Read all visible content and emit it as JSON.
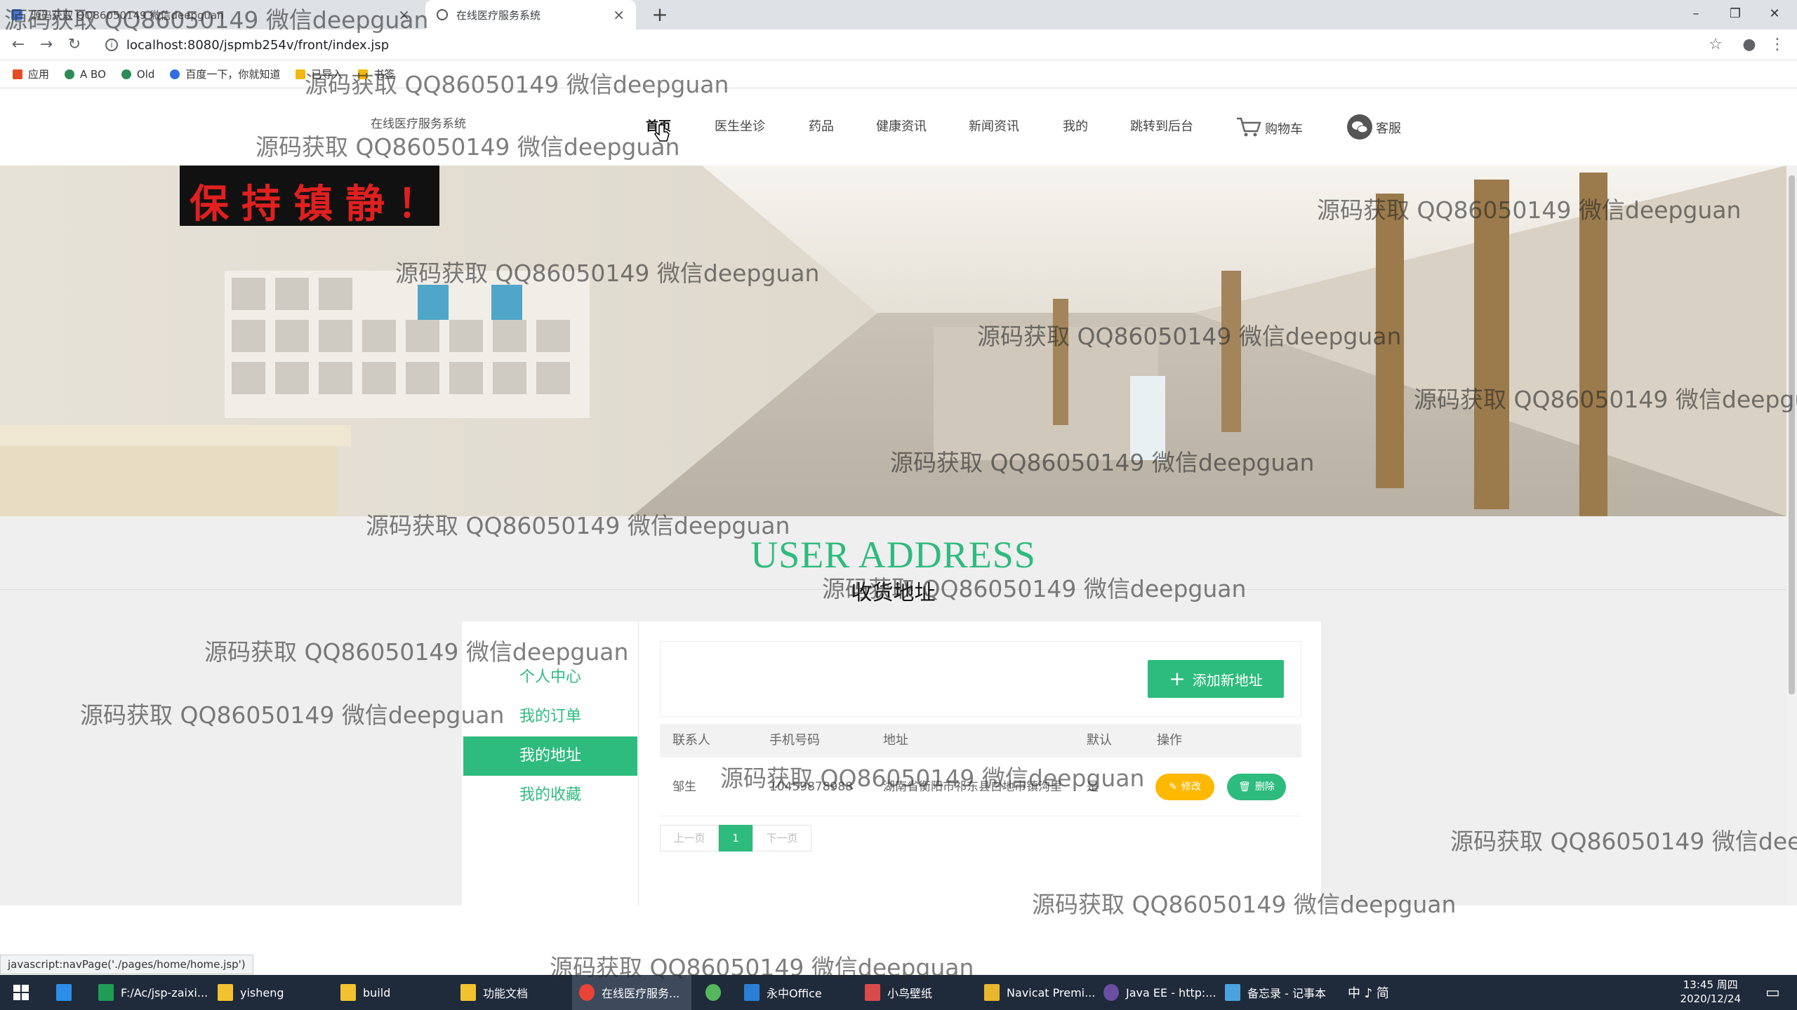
{
  "browser": {
    "tabs": [
      {
        "label": "源码获取 QQ86050149 微信deepguan",
        "active": false
      },
      {
        "label": "在线医疗服务系统",
        "active": true
      }
    ],
    "url": "localhost:8080/jspmb254v/front/index.jsp",
    "bookmarks": [
      "应用",
      "A BO",
      "Old",
      "百度一下，你就知道",
      "已导入",
      "书签"
    ],
    "status_text": "javascript:navPage('./pages/home/home.jsp')"
  },
  "site": {
    "brand": "在线医疗服务系统",
    "menu": [
      "首页",
      "医生坐诊",
      "药品",
      "健康资讯",
      "新闻资讯",
      "我的",
      "跳转到后台"
    ],
    "cart_label": "购物车",
    "service_label": "客服",
    "banner_sign": "保持镇静！",
    "accent_color": "#2ebb7e"
  },
  "section": {
    "title": "USER ADDRESS",
    "subtitle": "收货地址"
  },
  "sidebar": {
    "items": [
      {
        "label": "个人中心",
        "active": false
      },
      {
        "label": "我的订单",
        "active": false
      },
      {
        "label": "我的地址",
        "active": true
      },
      {
        "label": "我的收藏",
        "active": false
      }
    ]
  },
  "address": {
    "add_button": "添加新地址",
    "columns": [
      "联系人",
      "手机号码",
      "地址",
      "默认",
      "操作"
    ],
    "rows": [
      {
        "contact": "邹生",
        "phone": "10459878988",
        "address": "湖南省衡阳市祁东县白地市镇沟里",
        "default": "是"
      }
    ],
    "edit_label": "修改",
    "delete_label": "删除",
    "pager": {
      "prev": "上一页",
      "current": "1",
      "next": "下一页"
    }
  },
  "taskbar": {
    "items": [
      "F:/Ac/jsp-zaixi...",
      "yisheng",
      "build",
      "功能文档",
      "在线医疗服务...",
      "",
      "永中Office",
      "小鸟壁纸",
      "Navicat Premi...",
      "Java EE - http:...",
      "备忘录 - 记事本"
    ],
    "tray_text": "中 ♪ 简",
    "time": "13:45 周四",
    "date": "2020/12/24"
  },
  "watermark": "源码获取 QQ86050149 微信deepguan"
}
